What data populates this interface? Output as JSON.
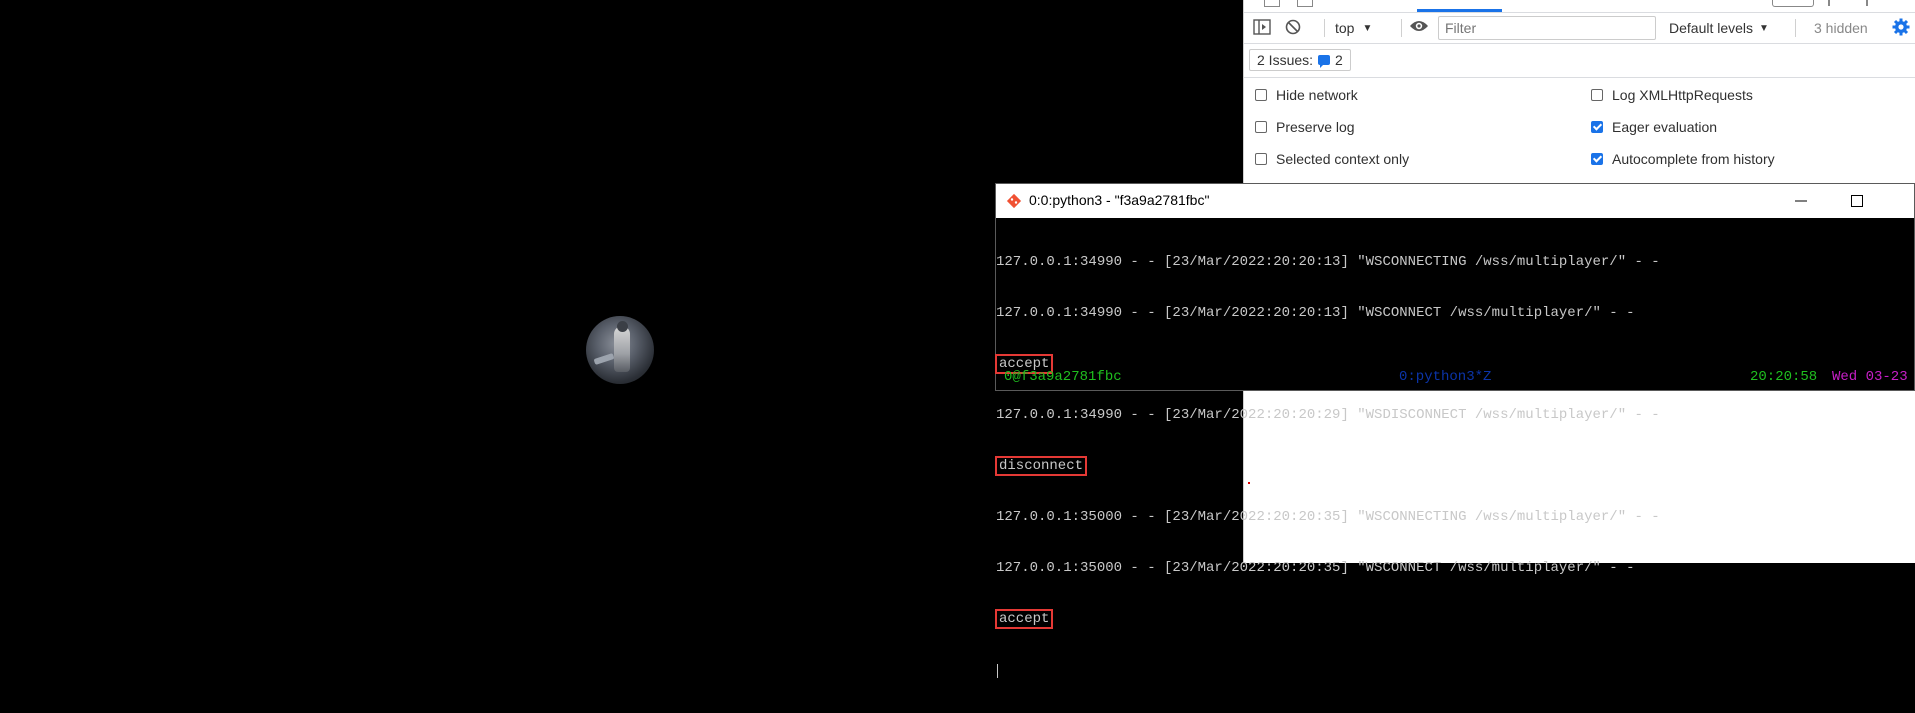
{
  "devtools": {
    "toolbar": {
      "context": "top",
      "filter_placeholder": "Filter",
      "levels": "Default levels",
      "hidden": "3 hidden"
    },
    "issues": {
      "label": "2 Issues:",
      "count": "2"
    },
    "settings": [
      {
        "label": "Hide network",
        "checked": false
      },
      {
        "label": "Preserve log",
        "checked": false
      },
      {
        "label": "Selected context only",
        "checked": false
      },
      {
        "label": "Log XMLHttpRequests",
        "checked": false
      },
      {
        "label": "Eager evaluation",
        "checked": true
      },
      {
        "label": "Autocomplete from history",
        "checked": true
      }
    ]
  },
  "terminal": {
    "title": "0:0:python3 - \"f3a9a2781fbc\"",
    "lines": [
      "127.0.0.1:34990 - - [23/Mar/2022:20:20:13] \"WSCONNECTING /wss/multiplayer/\" - -",
      "127.0.0.1:34990 - - [23/Mar/2022:20:20:13] \"WSCONNECT /wss/multiplayer/\" - -",
      "accept",
      "127.0.0.1:34990 - - [23/Mar/2022:20:20:29] \"WSDISCONNECT /wss/multiplayer/\" - -",
      "disconnect",
      "127.0.0.1:35000 - - [23/Mar/2022:20:20:35] \"WSCONNECTING /wss/multiplayer/\" - -",
      "127.0.0.1:35000 - - [23/Mar/2022:20:20:35] \"WSCONNECT /wss/multiplayer/\" - -",
      "accept"
    ],
    "status": {
      "left": "0@f3a9a2781fbc",
      "window": "0:python3*Z",
      "time": "20:20:58",
      "date": "Wed 03-23"
    }
  }
}
